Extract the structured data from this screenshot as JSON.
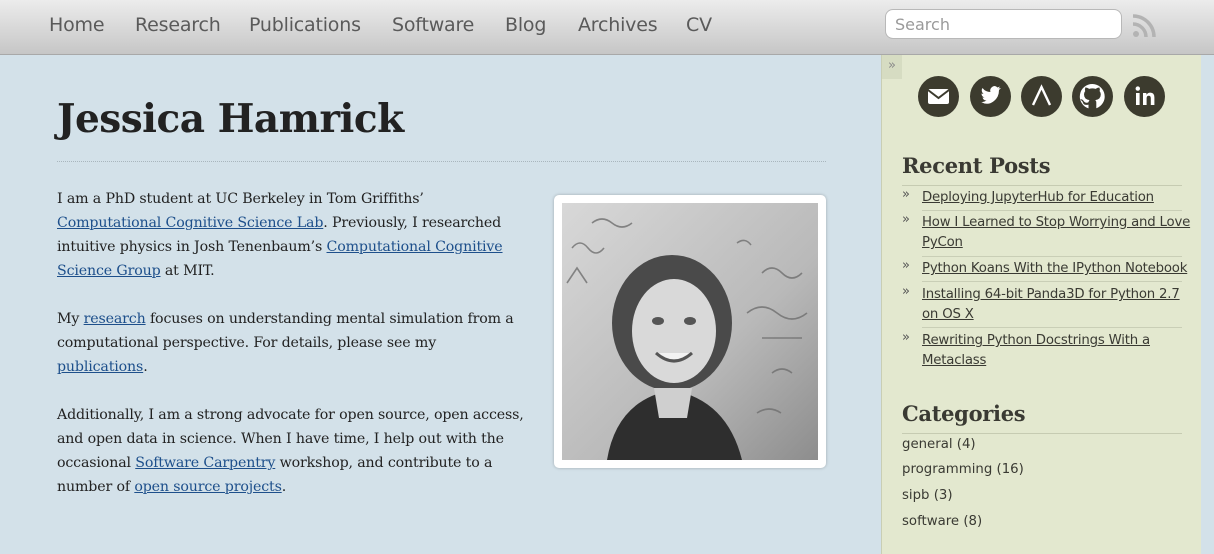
{
  "nav": {
    "items": [
      "Home",
      "Research",
      "Publications",
      "Software",
      "Blog",
      "Archives",
      "CV"
    ],
    "search_placeholder": "Search"
  },
  "icons": {
    "rss": "rss-icon",
    "social": [
      "email-icon",
      "twitter-icon",
      "arxiv-icon",
      "github-icon",
      "linkedin-icon"
    ]
  },
  "main": {
    "title": "Jessica Hamrick",
    "p1": {
      "t1": "I am a PhD student at UC Berkeley in Tom Griffiths’",
      "link1": "Computational Cognitive Science Lab",
      "t2": ". Previously, I researched intuitive physics in Josh Tenenbaum’s ",
      "link2": "Computational Cognitive Science Group",
      "t3": " at MIT."
    },
    "p2": {
      "t1": "My ",
      "link1": "research",
      "t2": " focuses on understanding mental simulation from a computational perspective. For details, please see my ",
      "link2": "publications",
      "t3": "."
    },
    "p3": {
      "t1": "Additionally, I am a strong advocate for open source, open access, and open data in science. When I have time, I help out with the occasional ",
      "link1": "Software Carpentry",
      "t2": " workshop, and contribute to a number of ",
      "link2": "open source projects",
      "t3": "."
    }
  },
  "sidebar": {
    "toggle": "»",
    "recent_posts_heading": "Recent Posts",
    "posts": [
      "Deploying JupyterHub for Education",
      "How I Learned to Stop Worrying and Love PyCon",
      "Python Koans With the IPython Notebook",
      "Installing 64-bit Panda3D for Python 2.7 on OS X",
      "Rewriting Python Docstrings With a Metaclass"
    ],
    "categories_heading": "Categories",
    "categories": [
      "general (4)",
      "programming (16)",
      "sipb (3)",
      "software (8)"
    ]
  },
  "colors": {
    "page_bg": "#d3e1e9",
    "sidebar_bg": "#e3e8cf",
    "link": "#1d4f8b",
    "social_bg": "#3c3b2e"
  }
}
